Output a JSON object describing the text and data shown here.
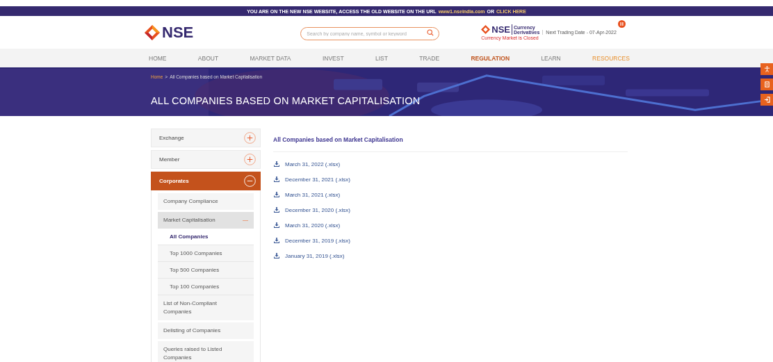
{
  "notice": {
    "parts": [
      {
        "text": "YOU ARE ON THE NEW NSE WEBSITE, ACCESS THE OLD WEBSITE ON THE URL",
        "kind": "plain"
      },
      {
        "text": "www1.nseindia.com",
        "kind": "link"
      },
      {
        "text": "OR",
        "kind": "plain"
      },
      {
        "text": "CLICK HERE",
        "kind": "link"
      }
    ]
  },
  "header": {
    "logo": "NSE",
    "search": {
      "placeholder": "Search by company name, symbol or keyword"
    },
    "segment": {
      "logo": "NSE",
      "label_1": "Currency",
      "label_2": "Derivatives",
      "status": "Currency Market is Closed"
    },
    "next_trading_date": "Next Trading Date - 07-Apr-2022"
  },
  "nav": [
    {
      "label": "HOME",
      "selected": false,
      "kind": "link"
    },
    {
      "label": "ABOUT",
      "selected": false,
      "kind": "link"
    },
    {
      "label": "MARKET DATA",
      "selected": false,
      "kind": "link"
    },
    {
      "label": "INVEST",
      "selected": false,
      "kind": "link"
    },
    {
      "label": "LIST",
      "selected": false,
      "kind": "link"
    },
    {
      "label": "TRADE",
      "selected": false,
      "kind": "link"
    },
    {
      "label": "REGULATION",
      "selected": true,
      "kind": "link"
    },
    {
      "label": "LEARN",
      "selected": false,
      "kind": "link"
    },
    {
      "label": "RESOURCES",
      "selected": false,
      "kind": "promo"
    }
  ],
  "banner": {
    "breadcrumb": [
      {
        "label": "Home",
        "kind": "link"
      },
      {
        "label": ">",
        "kind": "separator"
      },
      {
        "label": "All Companies based on Market Capitalisation",
        "kind": "current"
      }
    ],
    "title": "ALL COMPANIES BASED ON MARKET CAPITALISATION"
  },
  "sidebar": {
    "items": [
      {
        "label": "Exchange",
        "expanded": false
      },
      {
        "label": "Member",
        "expanded": false
      },
      {
        "label": "Corporates",
        "expanded": true,
        "children": [
          {
            "label": "Company Compliance",
            "expanded": false
          },
          {
            "label": "Market Capitalisation",
            "expanded": true,
            "children": [
              {
                "label": "All Companies",
                "selected": true
              },
              {
                "label": "Top 1000 Companies",
                "selected": false
              },
              {
                "label": "Top 500 Companies",
                "selected": false
              },
              {
                "label": "Top 100 Companies",
                "selected": false
              }
            ]
          },
          {
            "label": "List of Non-Compliant Companies",
            "expanded": false
          },
          {
            "label": "Delisting of Companies",
            "expanded": false
          },
          {
            "label": "Queries raised to Listed Companies",
            "expanded": false
          }
        ]
      }
    ]
  },
  "content": {
    "title": "All Companies based on Market Capitalisation",
    "downloads": [
      "March 31, 2022 (.xlsx)",
      "December 31, 2021 (.xlsx)",
      "March 31, 2021 (.xlsx)",
      "December 31, 2020 (.xlsx)",
      "March 31, 2020 (.xlsx)",
      "December 31, 2019 (.xlsx)",
      "January 31, 2019 (.xlsx)"
    ]
  },
  "side_buttons": [
    {
      "kind": "accessibility"
    },
    {
      "kind": "document"
    },
    {
      "kind": "login"
    }
  ]
}
